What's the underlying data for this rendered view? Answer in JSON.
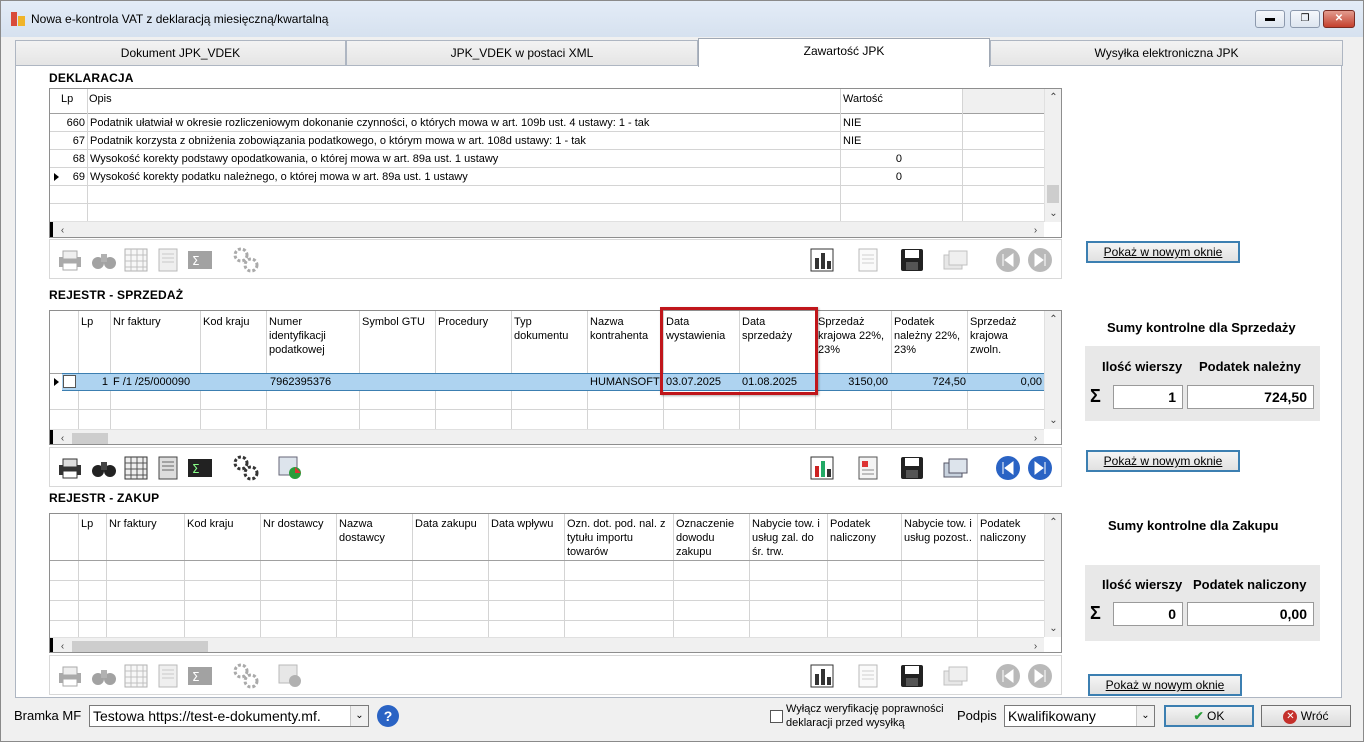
{
  "window": {
    "title": "Nowa e-kontrola VAT z deklaracją miesięczną/kwartalną",
    "min_label": "▬",
    "max_label": "❐",
    "close_label": "✕"
  },
  "tabs": [
    {
      "label": "Dokument JPK_VDEK"
    },
    {
      "label": "JPK_VDEK w postaci XML"
    },
    {
      "label": "Zawartość JPK"
    },
    {
      "label": "Wysyłka elektroniczna JPK"
    }
  ],
  "deklaracja": {
    "title": "DEKLARACJA",
    "headers": {
      "lp": "Lp",
      "opis": "Opis",
      "wartosc": "Wartość"
    },
    "rows": [
      {
        "lp": "660",
        "opis": "Podatnik ułatwiał w okresie rozliczeniowym dokonanie czynności, o których mowa w art. 109b ust. 4 ustawy: 1 - tak",
        "wartosc": "NIE"
      },
      {
        "lp": "67",
        "opis": "Podatnik korzysta z obniżenia zobowiązania podatkowego, o którym mowa w art. 108d ustawy: 1 - tak",
        "wartosc": "NIE"
      },
      {
        "lp": "68",
        "opis": "Wysokość korekty podstawy opodatkowania, o której mowa w art. 89a ust. 1 ustawy",
        "wartosc": "0"
      },
      {
        "lp": "69",
        "opis": "Wysokość korekty podatku należnego, o której mowa w art. 89a ust. 1 ustawy",
        "wartosc": "0"
      }
    ]
  },
  "sprzedaz": {
    "title": "REJESTR - SPRZEDAŻ",
    "headers": {
      "lp": "Lp",
      "nr_faktury": "Nr faktury",
      "kod_kraju": "Kod kraju",
      "numer_id": "Numer identyfikacji podatkowej",
      "symbol_gtu": "Symbol GTU",
      "procedury": "Procedury",
      "typ_dok": "Typ dokumentu",
      "nazwa": "Nazwa kontrahenta",
      "data_wyst": "Data wystawienia",
      "data_sprz": "Data sprzedaży",
      "sprz_22": "Sprzedaż krajowa 22%, 23%",
      "pod_22": "Podatek należny 22%, 23%",
      "sprz_zw": "Sprzedaż krajowa zwoln."
    },
    "row": {
      "lp": "1",
      "nr_faktury": "F /1  /25/000090",
      "numer_id": "7962395376",
      "nazwa": "HUMANSOFT S",
      "data_wyst": "03.07.2025",
      "data_sprz": "01.08.2025",
      "sprz_22": "3150,00",
      "pod_22": "724,50",
      "sprz_zw": "0,00"
    },
    "sum_title": "Sumy kontrolne dla Sprzedaży",
    "sum_count_label": "Ilość wierszy",
    "sum_value_label": "Podatek należny",
    "sum_count": "1",
    "sum_value": "724,50"
  },
  "zakup": {
    "title": "REJESTR - ZAKUP",
    "headers": {
      "lp": "Lp",
      "nr_faktury": "Nr faktury",
      "kod_kraju": "Kod kraju",
      "nr_dostawcy": "Nr dostawcy",
      "nazwa_dostawcy": "Nazwa dostawcy",
      "data_zakupu": "Data zakupu",
      "data_wplywu": "Data wpływu",
      "ozn_dot": "Ozn. dot. pod. nal. z tytułu importu towarów",
      "ozn_dowodu": "Oznaczenie dowodu zakupu",
      "nabycie_srodki": "Nabycie tow. i usług zal. do śr. trw.",
      "pod_nal_1": "Podatek naliczony",
      "nabycie_pozost": "Nabycie tow. i usług pozost..",
      "pod_nal_2": "Podatek naliczony"
    },
    "sum_title": "Sumy kontrolne dla Zakupu",
    "sum_count_label": "Ilość wierszy",
    "sum_value_label": "Podatek naliczony",
    "sum_count": "0",
    "sum_value": "0,00"
  },
  "show_new_window_label": "Pokaż w nowym oknie",
  "sigma": "Σ",
  "bottom": {
    "bramka_label": "Bramka MF",
    "bramka_value": "Testowa https://test-e-dokumenty.mf.",
    "verify_label_1": "Wyłącz weryfikację poprawności",
    "verify_label_2": "deklaracji przed wysyłką",
    "podpis_label": "Podpis",
    "podpis_value": "Kwalifikowany",
    "ok_label": "OK",
    "back_label": "Wróć"
  },
  "icons": {
    "printer": "printer-icon",
    "binoculars": "binoculars-icon",
    "grid": "grid-search-icon",
    "filter": "filter-icon",
    "sum": "sum-icon",
    "gears": "gears-icon",
    "chart": "chart-icon",
    "doc": "document-icon",
    "save": "save-icon",
    "copy": "copy-icon",
    "first": "first-record-icon",
    "last": "last-record-icon",
    "help": "help-icon"
  },
  "colors": {
    "selection": "#aed3f0",
    "highlight_box": "#c0161b",
    "accent": "#3c7fb1"
  }
}
